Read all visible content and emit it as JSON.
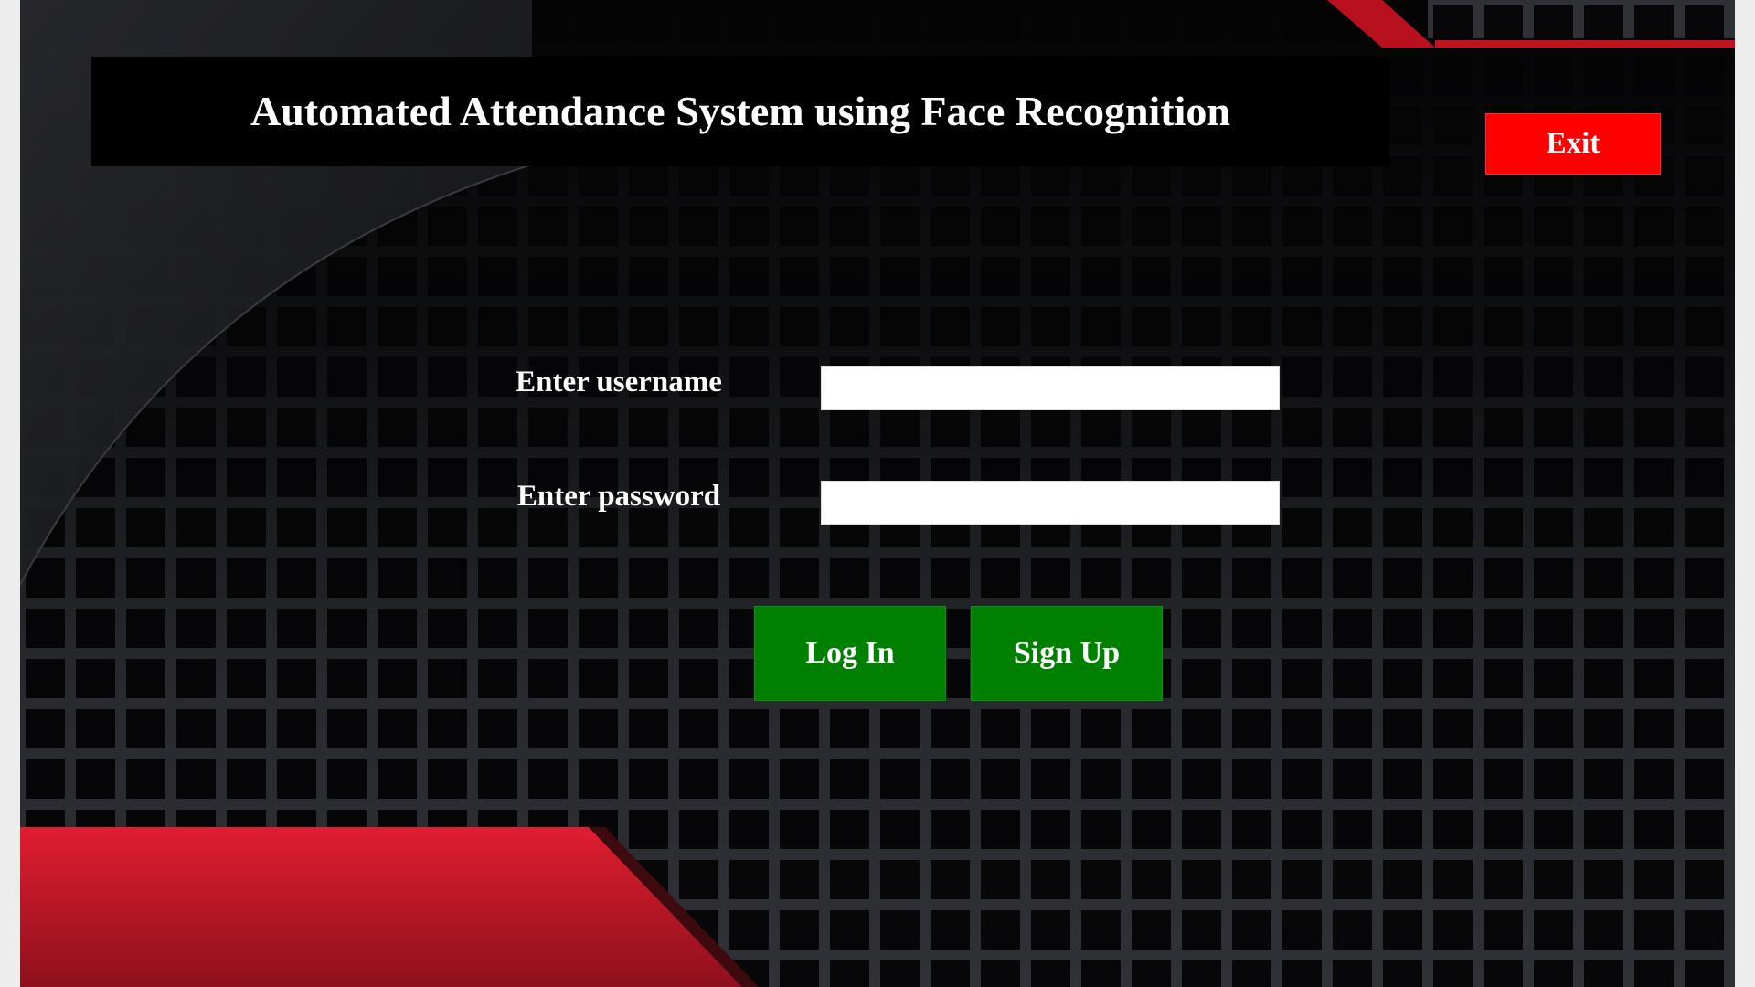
{
  "window": {
    "title": "Automated Attendance System using Face Recognition"
  },
  "exit_button": {
    "label": "Exit",
    "color": "#ff0000"
  },
  "form": {
    "username_label": "Enter username",
    "username_value": "",
    "password_label": "Enter password",
    "password_value": ""
  },
  "buttons": {
    "login_label": "Log In",
    "signup_label": "Sign Up",
    "color": "#008000"
  },
  "theme": {
    "background": "#050506",
    "accent_red": "#d3172a"
  }
}
